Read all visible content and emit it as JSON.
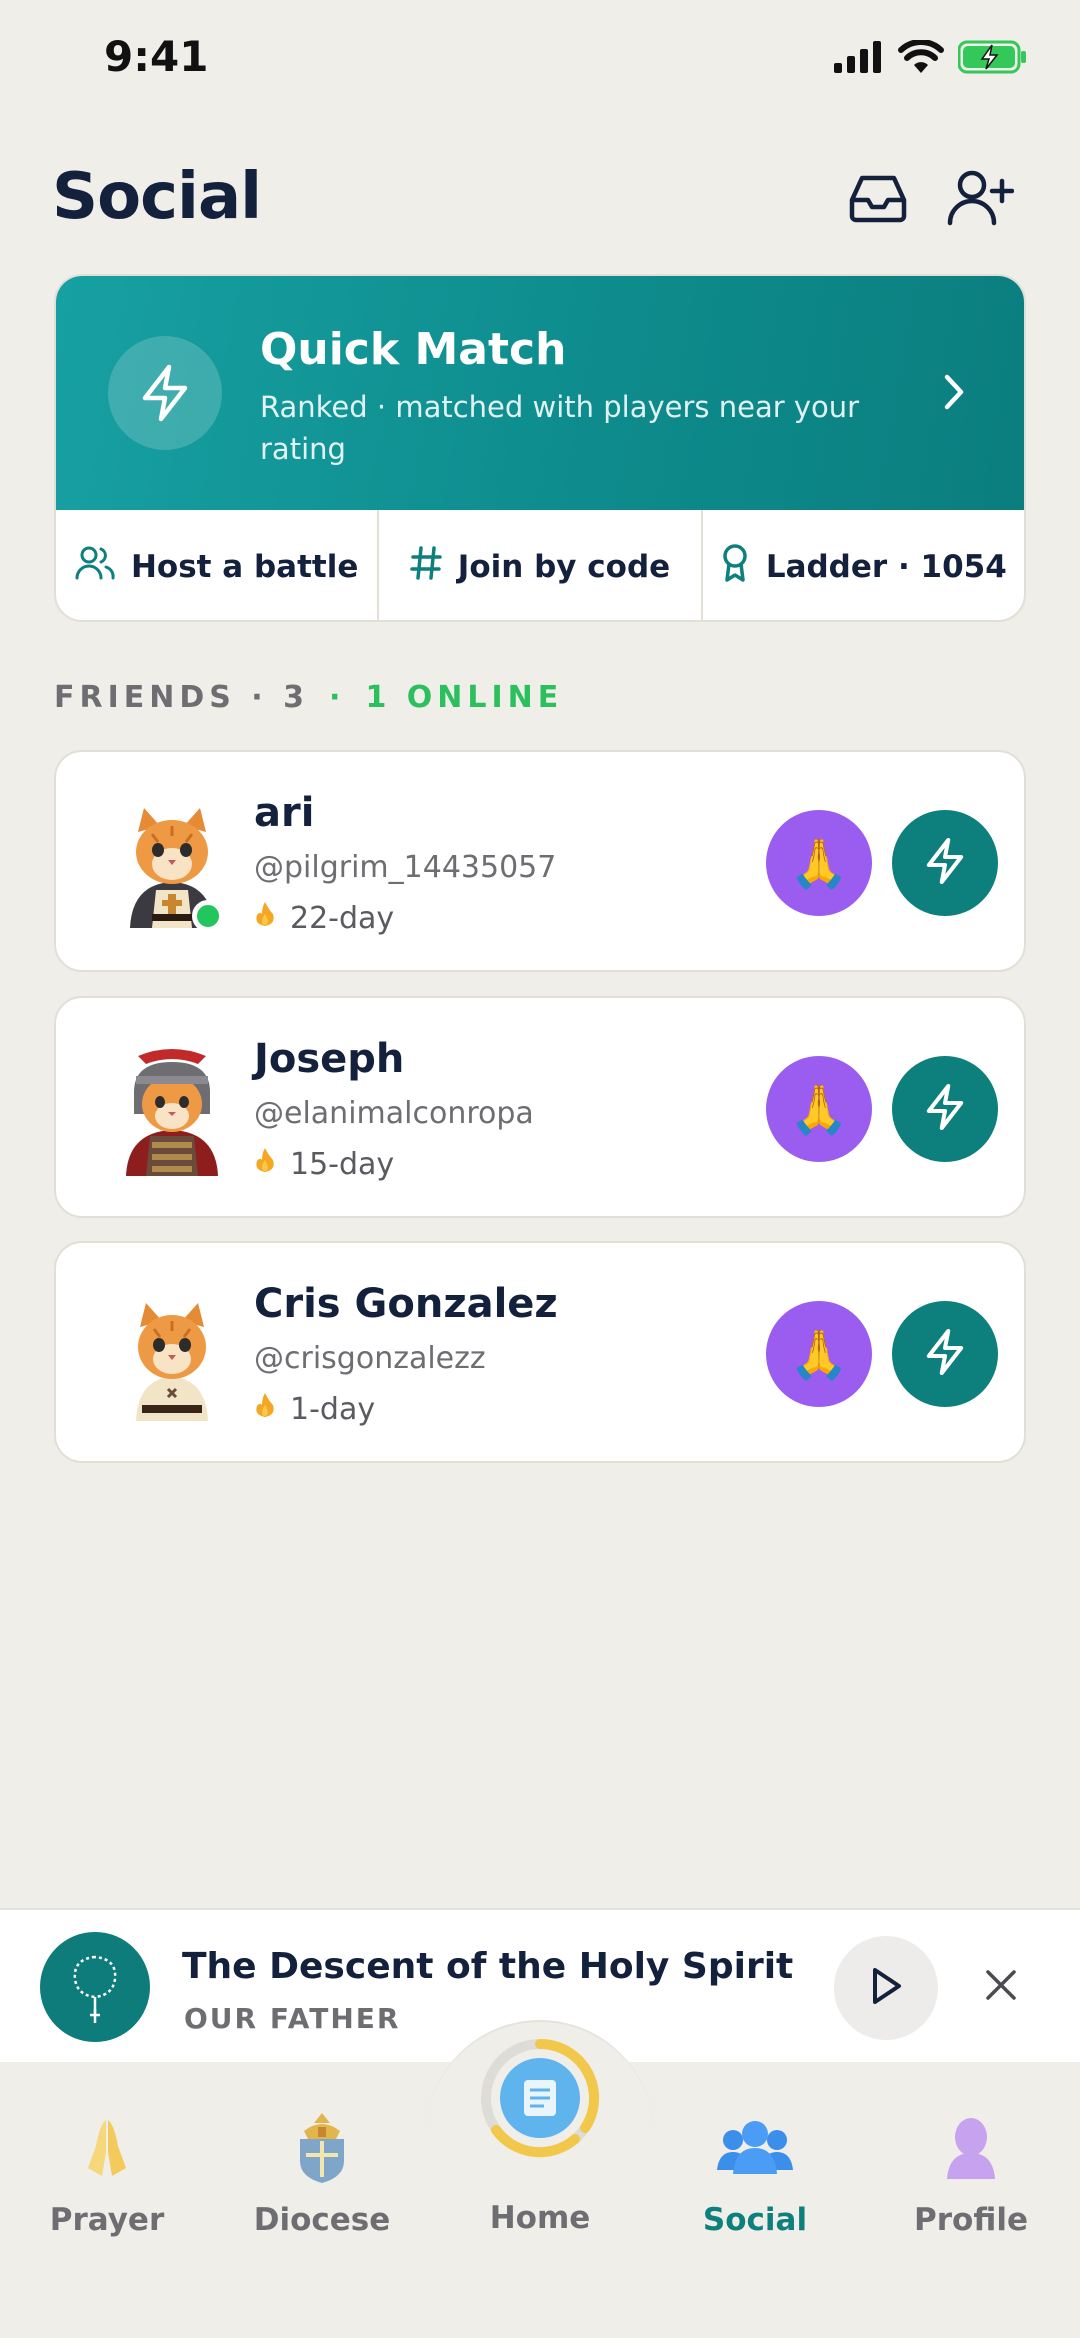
{
  "status_bar": {
    "time": "9:41"
  },
  "header": {
    "title": "Social"
  },
  "quick_match": {
    "title": "Quick Match",
    "subtitle": "Ranked · matched with players near your rating",
    "actions": [
      {
        "label": "Host a battle",
        "icon": "users-icon"
      },
      {
        "label": "Join by code",
        "icon": "hash-icon"
      },
      {
        "label": "Ladder · 1054",
        "icon": "award-icon"
      }
    ]
  },
  "friends_section": {
    "label": "FRIENDS · 3",
    "online": "1 ONLINE"
  },
  "friends": [
    {
      "name": "ari",
      "handle": "@pilgrim_14435057",
      "streak": "22-day",
      "online": true,
      "pray_emoji": "🙏"
    },
    {
      "name": "Joseph",
      "handle": "@elanimalconropa",
      "streak": "15-day",
      "online": false,
      "pray_emoji": "🙏"
    },
    {
      "name": "Cris Gonzalez",
      "handle": "@crisgonzalezz",
      "streak": "1-day",
      "online": false,
      "pray_emoji": "🙏"
    }
  ],
  "now_playing": {
    "title": "The Descent of the Holy Spirit",
    "subtitle": "OUR FATHER"
  },
  "tabs": [
    {
      "label": "Prayer"
    },
    {
      "label": "Diocese"
    },
    {
      "label": "Home"
    },
    {
      "label": "Social",
      "active": true
    },
    {
      "label": "Profile"
    }
  ],
  "colors": {
    "accent_teal": "#0D7F7D",
    "pray_purple": "#9B5CF0",
    "online_green": "#22C55E",
    "background": "#EFEEE9"
  }
}
